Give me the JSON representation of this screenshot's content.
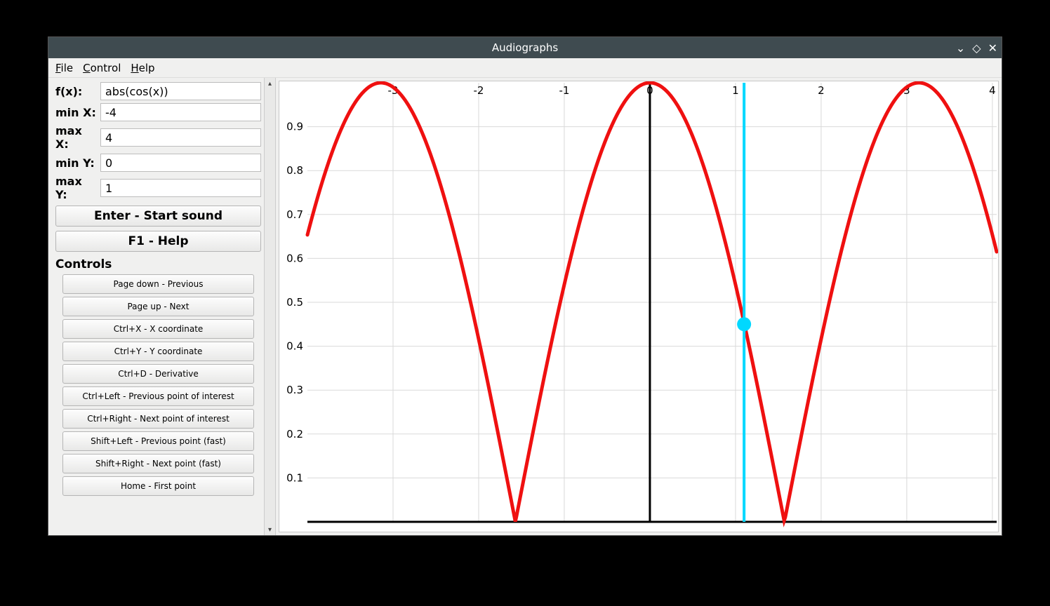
{
  "title": "Audiographs",
  "menu": {
    "file": "File",
    "control": "Control",
    "help": "Help"
  },
  "inputs": {
    "fx_label": "f(x):",
    "fx": "abs(cos(x))",
    "minx_label": "min X:",
    "minx": "-4",
    "maxx_label": "max X:",
    "maxx": "4",
    "miny_label": "min Y:",
    "miny": "0",
    "maxy_label": "max Y:",
    "maxy": "1"
  },
  "buttons": {
    "enter": "Enter - Start sound",
    "help": "F1 - Help"
  },
  "controls_header": "Controls",
  "controls": [
    "Page down - Previous",
    "Page up - Next",
    "Ctrl+X - X coordinate",
    "Ctrl+Y - Y coordinate",
    "Ctrl+D - Derivative",
    "Ctrl+Left - Previous point of interest",
    "Ctrl+Right - Next point of interest",
    "Shift+Left - Previous point (fast)",
    "Shift+Right - Next point (fast)",
    "Home - First point"
  ],
  "chart_data": {
    "type": "line",
    "title": "",
    "series": [
      {
        "name": "abs(cos(x))",
        "expr": "abs(cos(x))",
        "color": "#ef1010",
        "width": 5
      }
    ],
    "xlim": [
      -4,
      4.05
    ],
    "ylim": [
      0,
      1
    ],
    "xticks": [
      -3,
      -2,
      -1,
      0,
      1,
      2,
      3,
      4
    ],
    "yticks": [
      0.1,
      0.2,
      0.3,
      0.4,
      0.5,
      0.6,
      0.7,
      0.8,
      0.9
    ],
    "grid": true,
    "cursor": {
      "x": 1.1,
      "y": 0.45,
      "color": "#00d8ff"
    }
  }
}
